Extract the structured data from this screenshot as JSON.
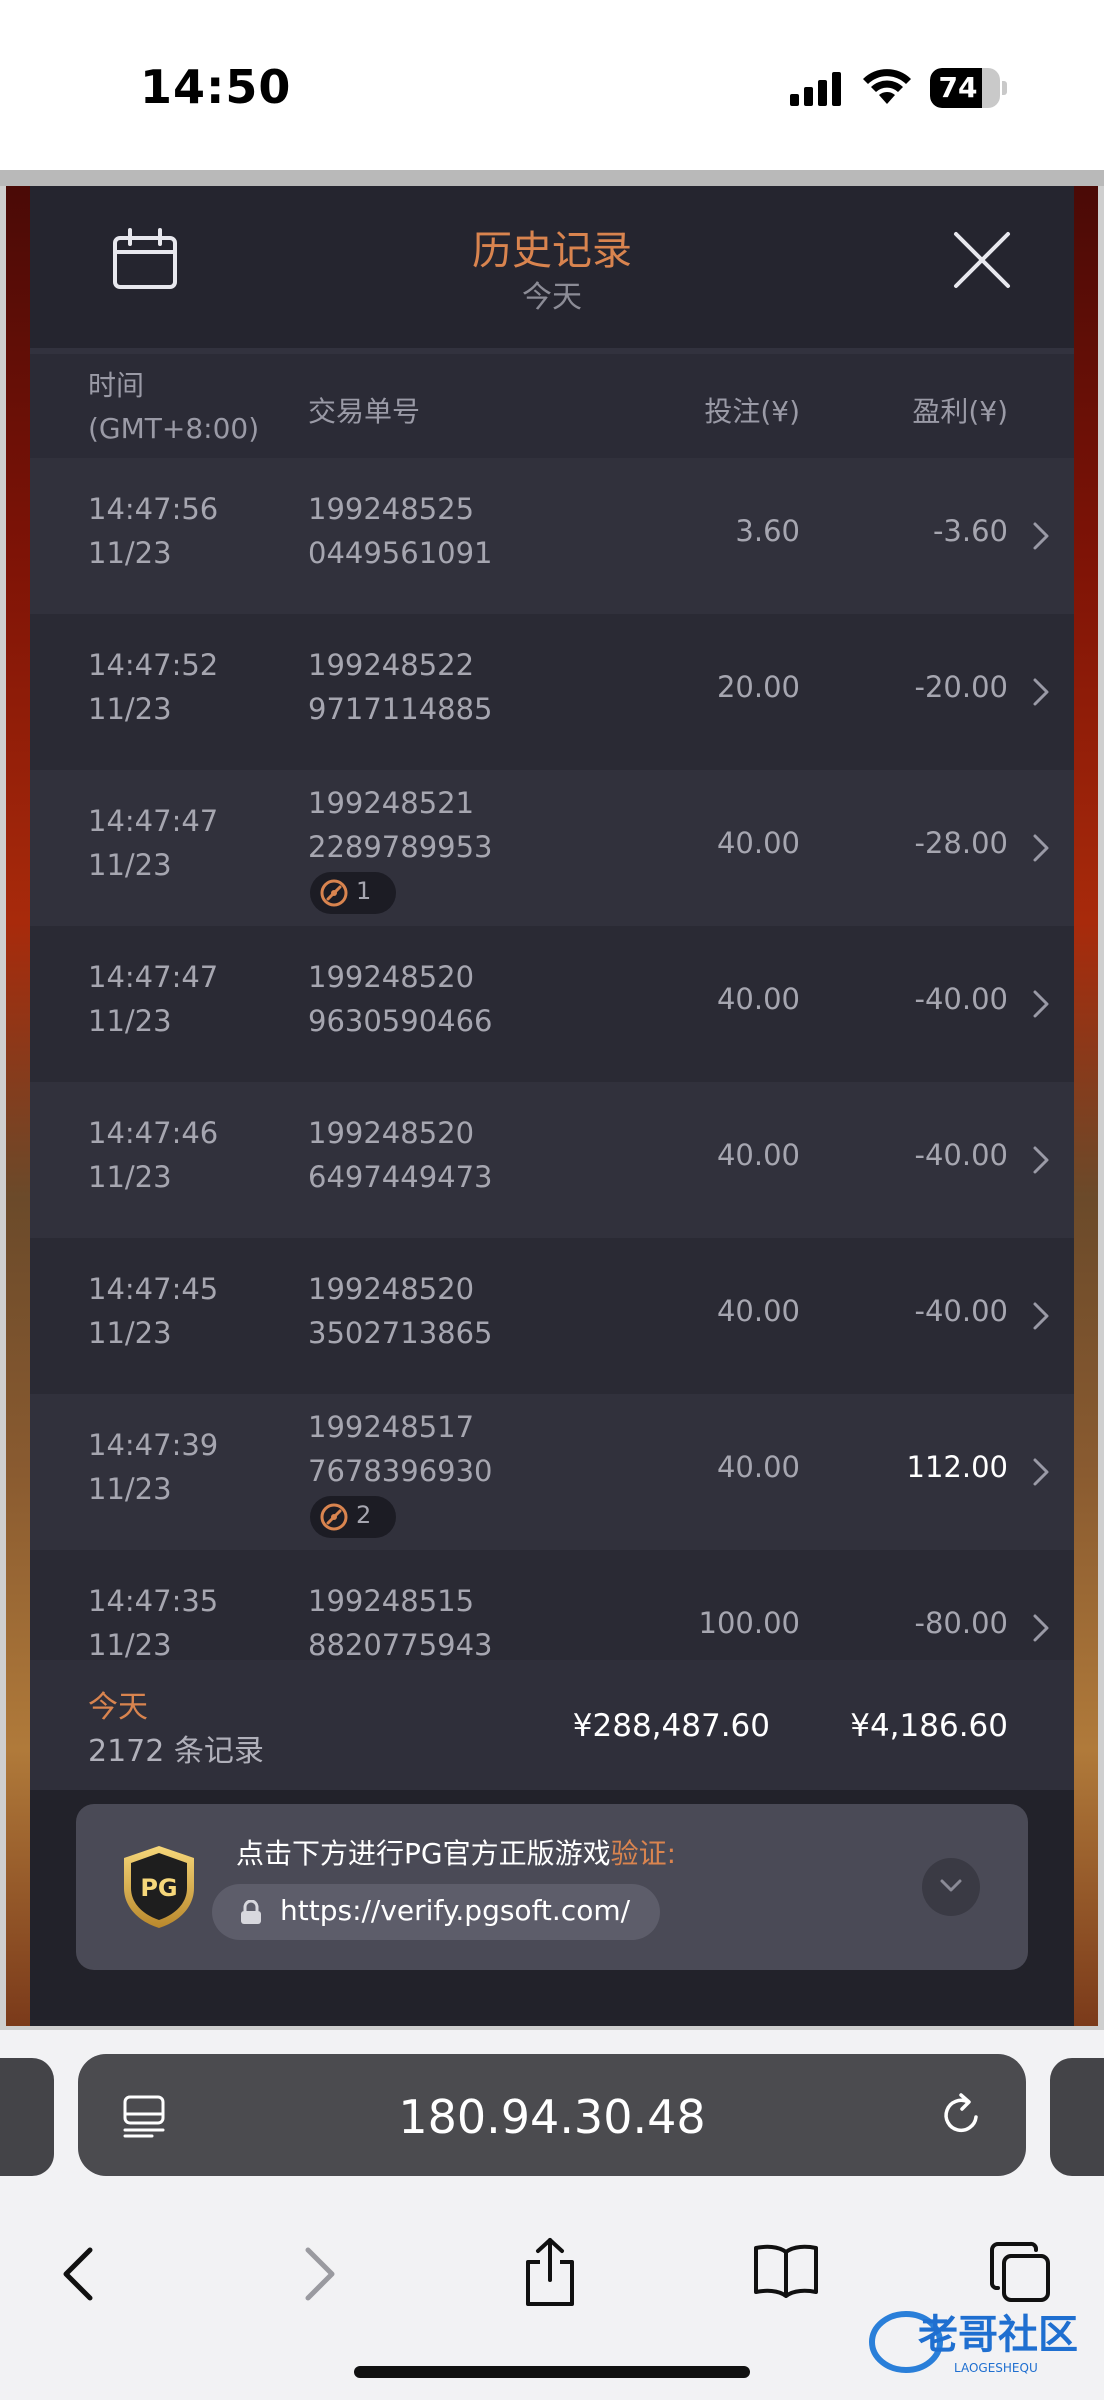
{
  "status_bar": {
    "time": "14:50",
    "battery": "74",
    "battery_level": 0.74
  },
  "panel": {
    "title": "历史记录",
    "subtitle": "今天",
    "columns": {
      "time": "时间",
      "timezone": "(GMT+8:00)",
      "transaction_id": "交易单号",
      "bet": "投注(¥)",
      "profit": "盈利(¥)"
    },
    "rows": [
      {
        "time": "14:47:56",
        "date": "11/23",
        "id_line1": "199248525",
        "id_line2": "0449561091",
        "bet": "3.60",
        "profit": "-3.60",
        "badge": ""
      },
      {
        "time": "14:47:52",
        "date": "11/23",
        "id_line1": "199248522",
        "id_line2": "9717114885",
        "bet": "20.00",
        "profit": "-20.00",
        "badge": ""
      },
      {
        "time": "14:47:47",
        "date": "11/23",
        "id_line1": "199248521",
        "id_line2": "2289789953",
        "bet": "40.00",
        "profit": "-28.00",
        "badge": "1"
      },
      {
        "time": "14:47:47",
        "date": "11/23",
        "id_line1": "199248520",
        "id_line2": "9630590466",
        "bet": "40.00",
        "profit": "-40.00",
        "badge": ""
      },
      {
        "time": "14:47:46",
        "date": "11/23",
        "id_line1": "199248520",
        "id_line2": "6497449473",
        "bet": "40.00",
        "profit": "-40.00",
        "badge": ""
      },
      {
        "time": "14:47:45",
        "date": "11/23",
        "id_line1": "199248520",
        "id_line2": "3502713865",
        "bet": "40.00",
        "profit": "-40.00",
        "badge": ""
      },
      {
        "time": "14:47:39",
        "date": "11/23",
        "id_line1": "199248517",
        "id_line2": "7678396930",
        "bet": "40.00",
        "profit": "112.00",
        "badge": "2"
      },
      {
        "time": "14:47:35",
        "date": "11/23",
        "id_line1": "199248515",
        "id_line2": "8820775943",
        "bet": "100.00",
        "profit": "-80.00",
        "badge": ""
      }
    ],
    "summary": {
      "label": "今天",
      "count": "2172 条记录",
      "total_bet": "¥288,487.60",
      "total_profit": "¥4,186.60"
    },
    "verify": {
      "text": "点击下方进行PG官方正版游戏",
      "highlight": "验证:",
      "url": "https://verify.pgsoft.com/",
      "logo_text": "PG"
    }
  },
  "browser": {
    "address": "180.94.30.48"
  },
  "watermark": {
    "text": "老哥社区",
    "subtext": "LAOGESHEQU"
  },
  "colors": {
    "accent": "#d9844f",
    "panel_bg": "#22222a",
    "row_odd": "#31313c",
    "row_even": "#2a2a34"
  }
}
